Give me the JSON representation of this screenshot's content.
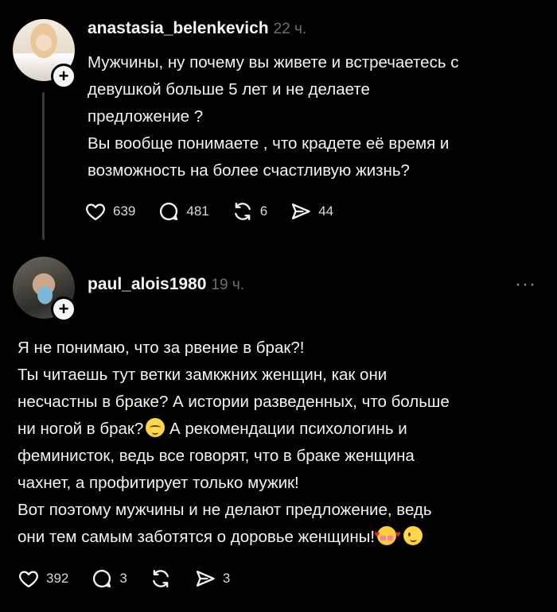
{
  "posts": [
    {
      "username": "anastasia_belenkevich",
      "time": "22 ч.",
      "lines": [
        "Мужчины, ну почему вы живете и встречаетесь с",
        "девушкой больше 5 лет и не делаете",
        "предложение ?",
        "Вы вообще понимаете , что крадете её время и",
        "возможность на более счастливую жизнь?"
      ],
      "likes": "639",
      "comments": "481",
      "reposts": "6",
      "shares": "44"
    },
    {
      "username": "paul_alois1980",
      "time": "19 ч.",
      "more": "···",
      "lines": [
        "Я не понимаю, что за рвение в брак?!",
        "Ты читаешь тут ветки замкжних женщин, как они",
        "несчастны в браке? А истории разведенных, что больше",
        "ни ногой в брак?",
        " А рекомендации психологинь и",
        "феминисток, ведь все говорят, что в браке женщина",
        "чахнет, а профитирует только мужик!",
        "Вот поэтому мужчины и не делают предложение, ведь",
        "они тем самым заботятся о доровье женщины!"
      ],
      "likes": "392",
      "comments": "3",
      "shares": "3"
    }
  ],
  "icons": {
    "plus": "+",
    "like": "heart-icon",
    "comment": "comment-icon",
    "repost": "repost-icon",
    "share": "send-icon",
    "emoji_relieved": "relieved-face-emoji",
    "emoji_hearts": "smiling-face-with-hearts-emoji",
    "emoji_wink": "winking-face-emoji"
  },
  "colors": {
    "background": "#000000",
    "text": "#f3f3f3",
    "muted": "#6e6e6e"
  }
}
